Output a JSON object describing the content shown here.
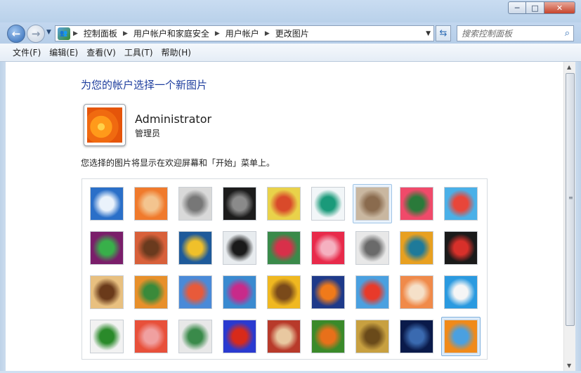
{
  "window": {
    "min_glyph": "─",
    "max_glyph": "□",
    "close_glyph": "✕"
  },
  "nav": {
    "back_glyph": "←",
    "forward_glyph": "→"
  },
  "address": {
    "crumbs": [
      "控制面板",
      "用户帐户和家庭安全",
      "用户帐户",
      "更改图片"
    ]
  },
  "search": {
    "placeholder": "搜索控制面板"
  },
  "menu": [
    "文件(F)",
    "编辑(E)",
    "查看(V)",
    "工具(T)",
    "帮助(H)"
  ],
  "page": {
    "title": "为您的帐户选择一个新图片",
    "user_name": "Administrator",
    "user_role": "管理员",
    "description": "您选择的图片将显示在欢迎屏幕和「开始」菜单上。"
  },
  "pictures": [
    {
      "name": "roller-coaster",
      "colors": [
        "#2a6fc8",
        "#eaf2fb"
      ]
    },
    {
      "name": "starfish",
      "colors": [
        "#f07a2c",
        "#f3c48f"
      ]
    },
    {
      "name": "robot-toy",
      "colors": [
        "#d9d9d9",
        "#777777"
      ]
    },
    {
      "name": "vinyl-record",
      "colors": [
        "#1c1c1c",
        "#8a8a8a"
      ]
    },
    {
      "name": "lucky-cat",
      "colors": [
        "#e9d24a",
        "#d94a2a"
      ]
    },
    {
      "name": "spinning-top",
      "colors": [
        "#f2f6f8",
        "#1a9a7a"
      ]
    },
    {
      "name": "kitten",
      "colors": [
        "#c9b7a0",
        "#8a6b4e"
      ]
    },
    {
      "name": "flower",
      "colors": [
        "#f04a6a",
        "#2a7a3a"
      ]
    },
    {
      "name": "ferris-wheel",
      "colors": [
        "#4ab0e8",
        "#e8463a"
      ]
    },
    {
      "name": "ball",
      "colors": [
        "#7a1e6a",
        "#38b04a"
      ]
    },
    {
      "name": "fabric",
      "colors": [
        "#d8603a",
        "#6a3a1e"
      ]
    },
    {
      "name": "leaf",
      "colors": [
        "#1e5a9a",
        "#f0c02a"
      ]
    },
    {
      "name": "dog-border-collie",
      "colors": [
        "#e8ecef",
        "#1a1a1a"
      ]
    },
    {
      "name": "crayons",
      "colors": [
        "#3a8a4a",
        "#d8304a"
      ]
    },
    {
      "name": "paper-star",
      "colors": [
        "#e82a4a",
        "#f5b0c0"
      ]
    },
    {
      "name": "jacks",
      "colors": [
        "#e8e8e8",
        "#6a6a6a"
      ]
    },
    {
      "name": "stairs",
      "colors": [
        "#e8a020",
        "#1e7a9a"
      ]
    },
    {
      "name": "origami-crane",
      "colors": [
        "#1a1a1a",
        "#d8302a"
      ]
    },
    {
      "name": "guitar",
      "colors": [
        "#e8c080",
        "#6a3a1a"
      ]
    },
    {
      "name": "puppy",
      "colors": [
        "#e8902a",
        "#3a8a3a"
      ]
    },
    {
      "name": "tin-robot",
      "colors": [
        "#4a8ad8",
        "#e85a3a"
      ]
    },
    {
      "name": "scarves",
      "colors": [
        "#3a8ad0",
        "#c82a8a"
      ]
    },
    {
      "name": "sunflower",
      "colors": [
        "#f0b820",
        "#7a4a1a"
      ]
    },
    {
      "name": "fish",
      "colors": [
        "#1e3a8a",
        "#f07a1a"
      ]
    },
    {
      "name": "hot-air-balloon",
      "colors": [
        "#4aa0e0",
        "#e83a2a"
      ]
    },
    {
      "name": "matryoshka",
      "colors": [
        "#f08a4a",
        "#f5e0c8"
      ]
    },
    {
      "name": "sailboat",
      "colors": [
        "#2a9ae0",
        "#f5f5f5"
      ]
    },
    {
      "name": "soccer-ball",
      "colors": [
        "#f2f2f2",
        "#2a8a2a"
      ]
    },
    {
      "name": "striped-cloth",
      "colors": [
        "#e8503a",
        "#f0a0a0"
      ]
    },
    {
      "name": "marbles",
      "colors": [
        "#e8e8e8",
        "#3a8a4a"
      ]
    },
    {
      "name": "window",
      "colors": [
        "#2a3ad0",
        "#d82a1a"
      ]
    },
    {
      "name": "carpet",
      "colors": [
        "#b83a2a",
        "#e8c8a0"
      ]
    },
    {
      "name": "butterfly",
      "colors": [
        "#3a8a2a",
        "#e8701a"
      ]
    },
    {
      "name": "shell",
      "colors": [
        "#c8a040",
        "#6a4a1a"
      ]
    },
    {
      "name": "lighthouse",
      "colors": [
        "#0a1a4a",
        "#3a6ab0"
      ]
    },
    {
      "name": "orange-flower",
      "colors": [
        "#f08a1a",
        "#4aa0e0"
      ]
    }
  ],
  "selected_picture": "orange-flower",
  "hover_picture": "kitten"
}
